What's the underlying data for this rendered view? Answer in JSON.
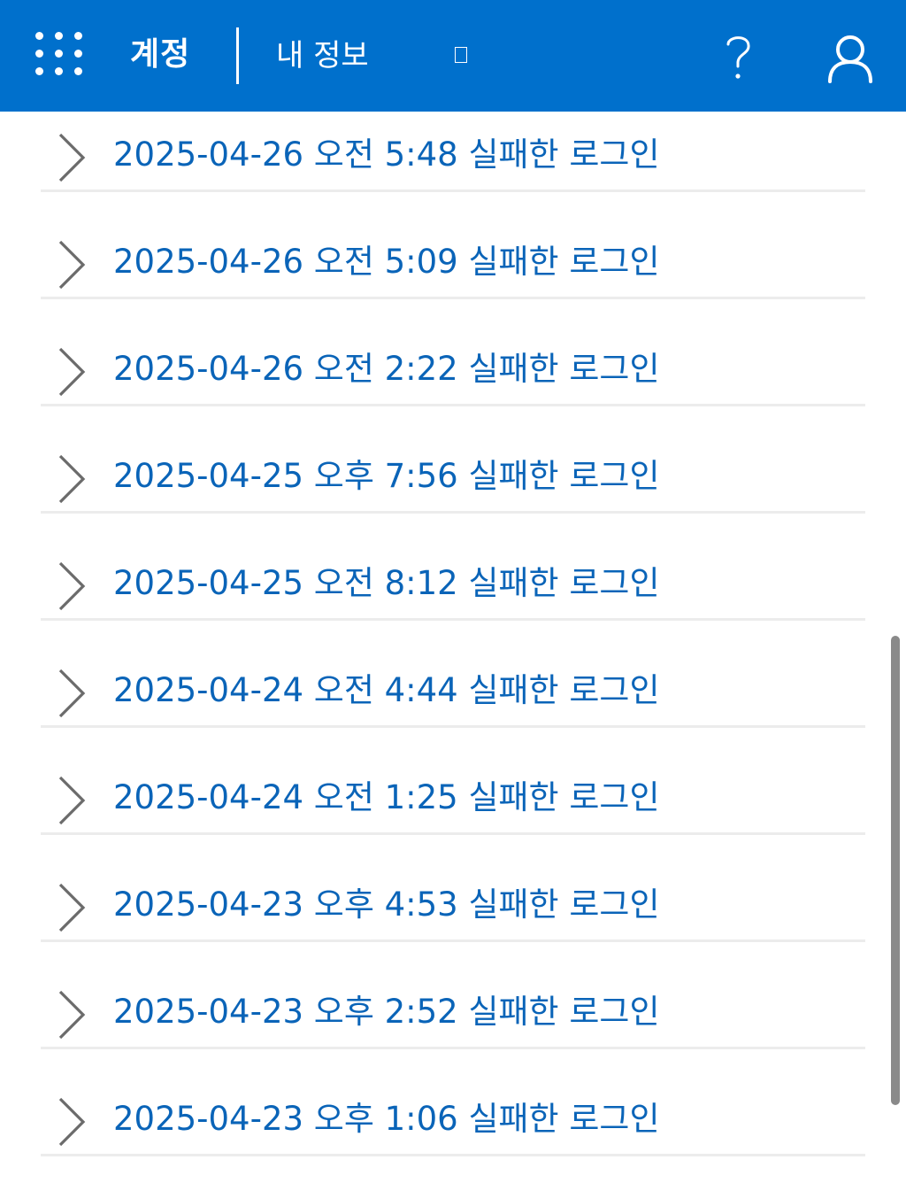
{
  "header": {
    "app_name": "계정",
    "breadcrumb": "내 정보",
    "icons": {
      "launcher": "app-launcher-waffle-icon",
      "help": "question-mark-icon",
      "account": "user-profile-icon"
    },
    "colors": {
      "bar": "#0070cc",
      "text": "#ffffff"
    }
  },
  "activity": {
    "link_color": "#0a64b8",
    "items": [
      {
        "label": "2025-04-26 오전 5:48 실패한 로그인"
      },
      {
        "label": "2025-04-26 오전 5:09 실패한 로그인"
      },
      {
        "label": "2025-04-26 오전 2:22 실패한 로그인"
      },
      {
        "label": "2025-04-25 오후 7:56 실패한 로그인"
      },
      {
        "label": "2025-04-25 오전 8:12 실패한 로그인"
      },
      {
        "label": "2025-04-24 오전 4:44 실패한 로그인"
      },
      {
        "label": "2025-04-24 오전 1:25 실패한 로그인"
      },
      {
        "label": "2025-04-23 오후 4:53 실패한 로그인"
      },
      {
        "label": "2025-04-23 오후 2:52 실패한 로그인"
      },
      {
        "label": "2025-04-23 오후 1:06 실패한 로그인"
      }
    ]
  }
}
